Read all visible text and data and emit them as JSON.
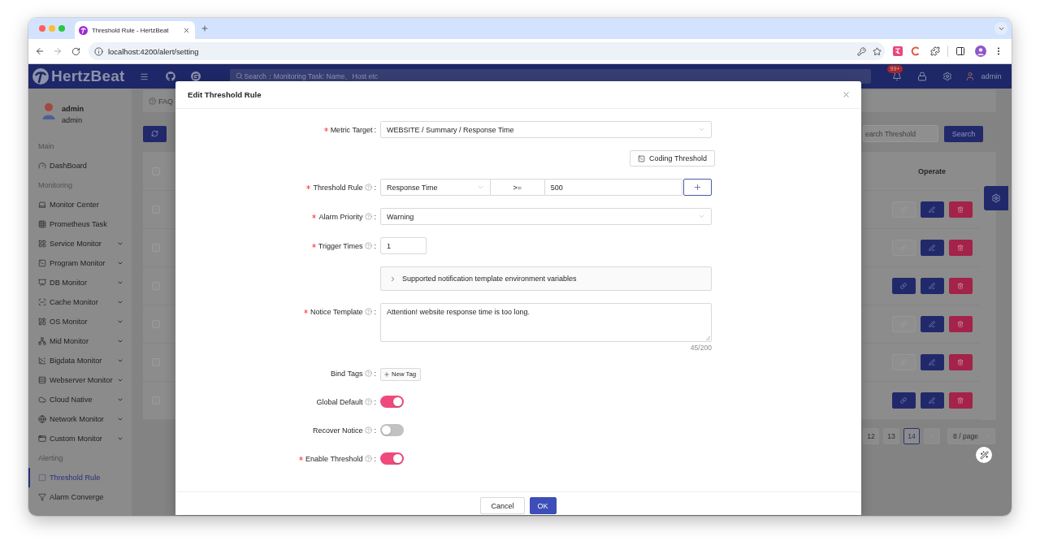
{
  "browser": {
    "tab_title": "Threshold Rule - HertzBeat",
    "address": "localhost:4200/alert/setting"
  },
  "header": {
    "brand": "HertzBeat",
    "search_placeholder": "Search：Monitoring Task: Name、Host etc",
    "badge": "99+",
    "user": "admin"
  },
  "sidebar": {
    "user": {
      "name": "admin",
      "role": "admin"
    },
    "groups": [
      {
        "title": "Main",
        "items": [
          {
            "label": "DashBoard",
            "expandable": false,
            "selected": false
          }
        ]
      },
      {
        "title": "Monitoring",
        "items": [
          {
            "label": "Monitor Center",
            "expandable": false,
            "selected": false
          },
          {
            "label": "Prometheus Task",
            "expandable": false,
            "selected": false
          },
          {
            "label": "Service Monitor",
            "expandable": true,
            "selected": false
          },
          {
            "label": "Program Monitor",
            "expandable": true,
            "selected": false
          },
          {
            "label": "DB Monitor",
            "expandable": true,
            "selected": false
          },
          {
            "label": "Cache Monitor",
            "expandable": true,
            "selected": false
          },
          {
            "label": "OS Monitor",
            "expandable": true,
            "selected": false
          },
          {
            "label": "Mid Monitor",
            "expandable": true,
            "selected": false
          },
          {
            "label": "Bigdata Monitor",
            "expandable": true,
            "selected": false
          },
          {
            "label": "Webserver Monitor",
            "expandable": true,
            "selected": false
          },
          {
            "label": "Cloud Native",
            "expandable": true,
            "selected": false
          },
          {
            "label": "Network Monitor",
            "expandable": true,
            "selected": false
          },
          {
            "label": "Custom Monitor",
            "expandable": true,
            "selected": false
          }
        ]
      },
      {
        "title": "Alerting",
        "items": [
          {
            "label": "Threshold Rule",
            "expandable": false,
            "selected": true
          },
          {
            "label": "Alarm Converge",
            "expandable": false,
            "selected": false
          }
        ]
      }
    ]
  },
  "page": {
    "breadcrumb": "FAQ",
    "search_placeholder": "earch Threshold",
    "search_button": "Search",
    "table": {
      "operate_header": "Operate",
      "all_checked": false,
      "rows": [
        {
          "checked": false,
          "link_enabled": false
        },
        {
          "checked": false,
          "link_enabled": false
        },
        {
          "checked": false,
          "link_enabled": true
        },
        {
          "checked": false,
          "link_enabled": false
        },
        {
          "checked": false,
          "link_enabled": false
        },
        {
          "checked": false,
          "link_enabled": true
        }
      ]
    },
    "pagination": {
      "pages": [
        {
          "label": "12",
          "selected": false
        },
        {
          "label": "13",
          "selected": false
        },
        {
          "label": "14",
          "selected": true
        }
      ],
      "next_disabled": true,
      "page_size": "8 / page"
    }
  },
  "dialog": {
    "title": "Edit Threshold Rule",
    "fields": [
      {
        "kind": "select",
        "label": "Metric Target",
        "colon": ":",
        "required": true,
        "help": false,
        "value": "WEBSITE / Summary / Response Time"
      },
      {
        "kind": "action",
        "button": "Coding Threshold"
      },
      {
        "kind": "rule",
        "label": "Threshold Rule",
        "colon": ":",
        "required": true,
        "help": true,
        "metric": "Response Time",
        "operator": ">=",
        "value": "500"
      },
      {
        "kind": "select",
        "label": "Alarm Priority",
        "colon": ":",
        "required": true,
        "help": true,
        "value": "Warning"
      },
      {
        "kind": "input",
        "label": "Trigger Times",
        "colon": ":",
        "required": true,
        "help": true,
        "value": "1"
      },
      {
        "kind": "collapse",
        "title": "Supported notification template environment variables",
        "expanded": false
      },
      {
        "kind": "textarea",
        "label": "Notice Template",
        "colon": ":",
        "required": true,
        "help": true,
        "value": "Attention! website response time is too long.",
        "counter": "45/200"
      },
      {
        "kind": "tags",
        "label": "Bind Tags",
        "colon": ":",
        "required": false,
        "help": true,
        "button": "New Tag"
      },
      {
        "kind": "switch",
        "label": "Global Default",
        "colon": ":",
        "required": false,
        "help": true,
        "on": true
      },
      {
        "kind": "switch",
        "label": "Recover Notice",
        "colon": ":",
        "required": false,
        "help": true,
        "on": false
      },
      {
        "kind": "switch",
        "label": "Enable Threshold",
        "colon": ":",
        "required": true,
        "help": true,
        "on": true
      }
    ],
    "cancel": "Cancel",
    "ok": "OK"
  }
}
